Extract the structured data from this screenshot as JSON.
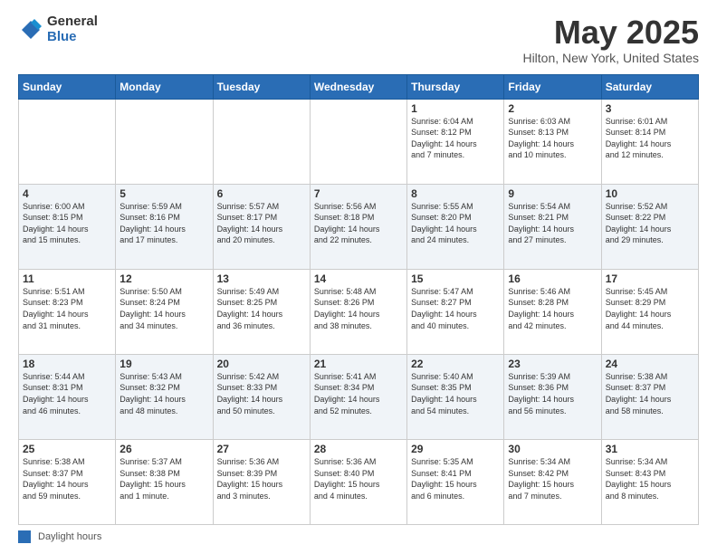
{
  "header": {
    "logo_general": "General",
    "logo_blue": "Blue",
    "title": "May 2025",
    "subtitle": "Hilton, New York, United States"
  },
  "weekdays": [
    "Sunday",
    "Monday",
    "Tuesday",
    "Wednesday",
    "Thursday",
    "Friday",
    "Saturday"
  ],
  "weeks": [
    [
      {
        "num": "",
        "info": ""
      },
      {
        "num": "",
        "info": ""
      },
      {
        "num": "",
        "info": ""
      },
      {
        "num": "",
        "info": ""
      },
      {
        "num": "1",
        "info": "Sunrise: 6:04 AM\nSunset: 8:12 PM\nDaylight: 14 hours\nand 7 minutes."
      },
      {
        "num": "2",
        "info": "Sunrise: 6:03 AM\nSunset: 8:13 PM\nDaylight: 14 hours\nand 10 minutes."
      },
      {
        "num": "3",
        "info": "Sunrise: 6:01 AM\nSunset: 8:14 PM\nDaylight: 14 hours\nand 12 minutes."
      }
    ],
    [
      {
        "num": "4",
        "info": "Sunrise: 6:00 AM\nSunset: 8:15 PM\nDaylight: 14 hours\nand 15 minutes."
      },
      {
        "num": "5",
        "info": "Sunrise: 5:59 AM\nSunset: 8:16 PM\nDaylight: 14 hours\nand 17 minutes."
      },
      {
        "num": "6",
        "info": "Sunrise: 5:57 AM\nSunset: 8:17 PM\nDaylight: 14 hours\nand 20 minutes."
      },
      {
        "num": "7",
        "info": "Sunrise: 5:56 AM\nSunset: 8:18 PM\nDaylight: 14 hours\nand 22 minutes."
      },
      {
        "num": "8",
        "info": "Sunrise: 5:55 AM\nSunset: 8:20 PM\nDaylight: 14 hours\nand 24 minutes."
      },
      {
        "num": "9",
        "info": "Sunrise: 5:54 AM\nSunset: 8:21 PM\nDaylight: 14 hours\nand 27 minutes."
      },
      {
        "num": "10",
        "info": "Sunrise: 5:52 AM\nSunset: 8:22 PM\nDaylight: 14 hours\nand 29 minutes."
      }
    ],
    [
      {
        "num": "11",
        "info": "Sunrise: 5:51 AM\nSunset: 8:23 PM\nDaylight: 14 hours\nand 31 minutes."
      },
      {
        "num": "12",
        "info": "Sunrise: 5:50 AM\nSunset: 8:24 PM\nDaylight: 14 hours\nand 34 minutes."
      },
      {
        "num": "13",
        "info": "Sunrise: 5:49 AM\nSunset: 8:25 PM\nDaylight: 14 hours\nand 36 minutes."
      },
      {
        "num": "14",
        "info": "Sunrise: 5:48 AM\nSunset: 8:26 PM\nDaylight: 14 hours\nand 38 minutes."
      },
      {
        "num": "15",
        "info": "Sunrise: 5:47 AM\nSunset: 8:27 PM\nDaylight: 14 hours\nand 40 minutes."
      },
      {
        "num": "16",
        "info": "Sunrise: 5:46 AM\nSunset: 8:28 PM\nDaylight: 14 hours\nand 42 minutes."
      },
      {
        "num": "17",
        "info": "Sunrise: 5:45 AM\nSunset: 8:29 PM\nDaylight: 14 hours\nand 44 minutes."
      }
    ],
    [
      {
        "num": "18",
        "info": "Sunrise: 5:44 AM\nSunset: 8:31 PM\nDaylight: 14 hours\nand 46 minutes."
      },
      {
        "num": "19",
        "info": "Sunrise: 5:43 AM\nSunset: 8:32 PM\nDaylight: 14 hours\nand 48 minutes."
      },
      {
        "num": "20",
        "info": "Sunrise: 5:42 AM\nSunset: 8:33 PM\nDaylight: 14 hours\nand 50 minutes."
      },
      {
        "num": "21",
        "info": "Sunrise: 5:41 AM\nSunset: 8:34 PM\nDaylight: 14 hours\nand 52 minutes."
      },
      {
        "num": "22",
        "info": "Sunrise: 5:40 AM\nSunset: 8:35 PM\nDaylight: 14 hours\nand 54 minutes."
      },
      {
        "num": "23",
        "info": "Sunrise: 5:39 AM\nSunset: 8:36 PM\nDaylight: 14 hours\nand 56 minutes."
      },
      {
        "num": "24",
        "info": "Sunrise: 5:38 AM\nSunset: 8:37 PM\nDaylight: 14 hours\nand 58 minutes."
      }
    ],
    [
      {
        "num": "25",
        "info": "Sunrise: 5:38 AM\nSunset: 8:37 PM\nDaylight: 14 hours\nand 59 minutes."
      },
      {
        "num": "26",
        "info": "Sunrise: 5:37 AM\nSunset: 8:38 PM\nDaylight: 15 hours\nand 1 minute."
      },
      {
        "num": "27",
        "info": "Sunrise: 5:36 AM\nSunset: 8:39 PM\nDaylight: 15 hours\nand 3 minutes."
      },
      {
        "num": "28",
        "info": "Sunrise: 5:36 AM\nSunset: 8:40 PM\nDaylight: 15 hours\nand 4 minutes."
      },
      {
        "num": "29",
        "info": "Sunrise: 5:35 AM\nSunset: 8:41 PM\nDaylight: 15 hours\nand 6 minutes."
      },
      {
        "num": "30",
        "info": "Sunrise: 5:34 AM\nSunset: 8:42 PM\nDaylight: 15 hours\nand 7 minutes."
      },
      {
        "num": "31",
        "info": "Sunrise: 5:34 AM\nSunset: 8:43 PM\nDaylight: 15 hours\nand 8 minutes."
      }
    ]
  ],
  "footer": {
    "box_label": "Daylight hours"
  }
}
